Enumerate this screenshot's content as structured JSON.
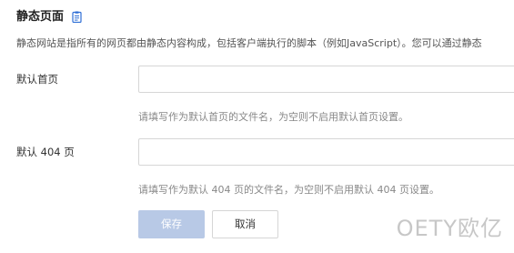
{
  "section": {
    "title": "静态页面",
    "description": "静态网站是指所有的网页都由静态内容构成，包括客户端执行的脚本（例如JavaScript）。您可以通过静态"
  },
  "index_page": {
    "label": "默认首页",
    "value": "",
    "help": "请填写作为默认首页的文件名，为空则不启用默认首页设置。"
  },
  "not_found_page": {
    "label": "默认 404 页",
    "value": "",
    "help": "请填写作为默认 404 页的文件名，为空则不启用默认 404 页设置。"
  },
  "actions": {
    "save_label": "保存",
    "cancel_label": "取消"
  },
  "watermark": "OETY欧亿",
  "colors": {
    "save_button_bg": "#b8c9e6",
    "icon_blue": "#2f6fd6",
    "input_border": "#d6d6d6"
  }
}
